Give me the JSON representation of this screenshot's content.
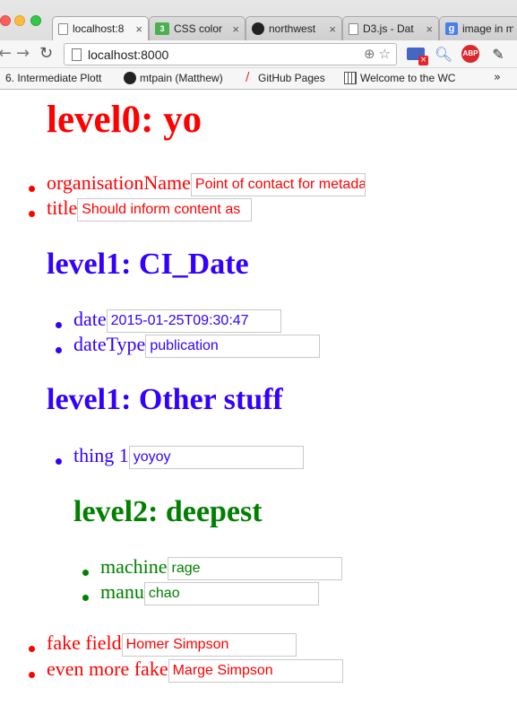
{
  "browser": {
    "tabs": [
      {
        "title": "localhost:8",
        "icon": "page-icon"
      },
      {
        "title": "CSS color",
        "icon": "css3-icon"
      },
      {
        "title": "northwest",
        "icon": "github-icon"
      },
      {
        "title": "D3.js - Dat",
        "icon": "page-icon"
      },
      {
        "title": "image in m",
        "icon": "google-icon"
      }
    ],
    "address": "localhost:8000",
    "bookmarks": [
      {
        "label": "6. Intermediate Plott",
        "icon": "none"
      },
      {
        "label": "mtpain (Matthew)",
        "icon": "github-icon"
      },
      {
        "label": "GitHub Pages",
        "icon": "pen-icon"
      },
      {
        "label": "Welcome to the WC",
        "icon": "w3c-icon"
      }
    ],
    "bookmarks_overflow": "»",
    "tab_close": "×",
    "cast_badge": "×",
    "abp_label": "ABP"
  },
  "page": {
    "level0": {
      "heading": "level0: yo",
      "color": "#ff0000",
      "fields": [
        {
          "label": "organisationName",
          "value": "Point of contact for metadata"
        },
        {
          "label": "title",
          "value": "Should inform content as"
        }
      ]
    },
    "ci_date": {
      "heading": "level1: CI_Date",
      "color": "#3300ff",
      "fields": [
        {
          "label": "date",
          "value": "2015-01-25T09:30:47"
        },
        {
          "label": "dateType",
          "value": "publication"
        }
      ]
    },
    "other_stuff": {
      "heading": "level1: Other stuff",
      "color": "#3300ff",
      "fields": [
        {
          "label": "thing 1",
          "value": "yoyoy"
        }
      ]
    },
    "deepest": {
      "heading": "level2: deepest",
      "color": "#008000",
      "fields": [
        {
          "label": "machine",
          "value": "rage"
        },
        {
          "label": "manu",
          "value": "chao"
        }
      ]
    },
    "trailing": {
      "color": "#ff0000",
      "fields": [
        {
          "label": "fake field",
          "value": "Homer Simpson"
        },
        {
          "label": "even more fake",
          "value": "Marge Simpson"
        }
      ]
    }
  }
}
